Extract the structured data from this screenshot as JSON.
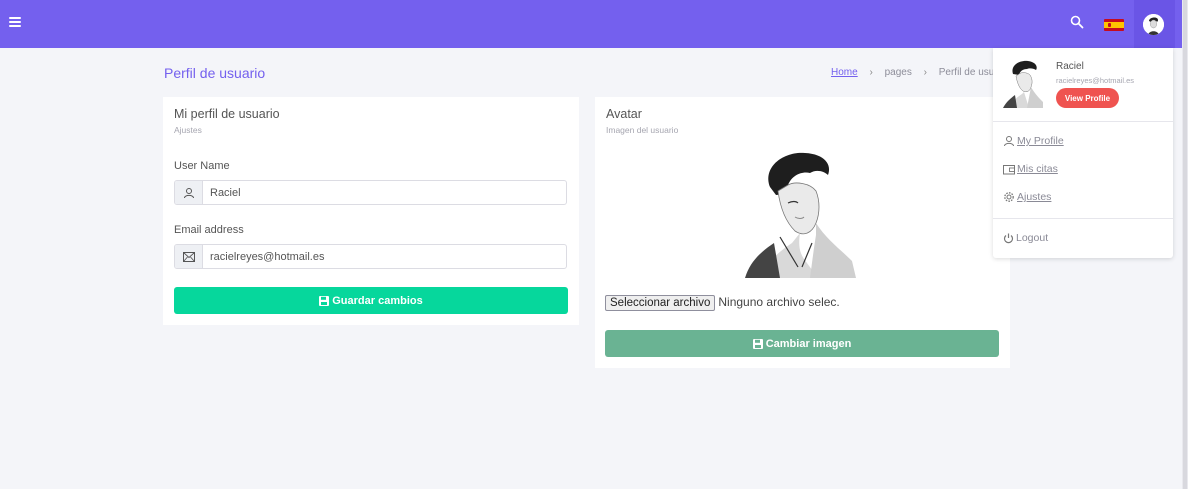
{
  "header": {
    "menu_icon": "hamburger-icon",
    "search_icon": "search-icon",
    "language_flag": "spain-flag-icon",
    "brand_color": "#7460ee"
  },
  "page": {
    "title": "Perfil de usuario",
    "breadcrumb": [
      "Home",
      "pages",
      "Perfil de usuario"
    ]
  },
  "profile_card": {
    "title": "Mi perfil de usuario",
    "subtitle": "Ajustes",
    "username_label": "User Name",
    "username_value": "Raciel",
    "email_label": "Email address",
    "email_value": "racielreyes@hotmail.es",
    "save_button": "Guardar cambios",
    "save_color": "#06d79c"
  },
  "avatar_card": {
    "title": "Avatar",
    "subtitle": "Imagen del usuario",
    "file_button": "Seleccionar archivo",
    "file_status": "Ninguno archivo selec.",
    "change_button": "Cambiar imagen",
    "change_color": "#6ab393"
  },
  "user_menu": {
    "name": "Raciel",
    "email": "racielreyes@hotmail.es",
    "view_profile": "View Profile",
    "items": [
      {
        "label": "My Profile",
        "icon": "user-icon"
      },
      {
        "label": "Mis citas",
        "icon": "wallet-icon"
      },
      {
        "label": "Ajustes",
        "icon": "gear-icon"
      }
    ],
    "logout": "Logout",
    "view_profile_color": "#ef5350"
  }
}
